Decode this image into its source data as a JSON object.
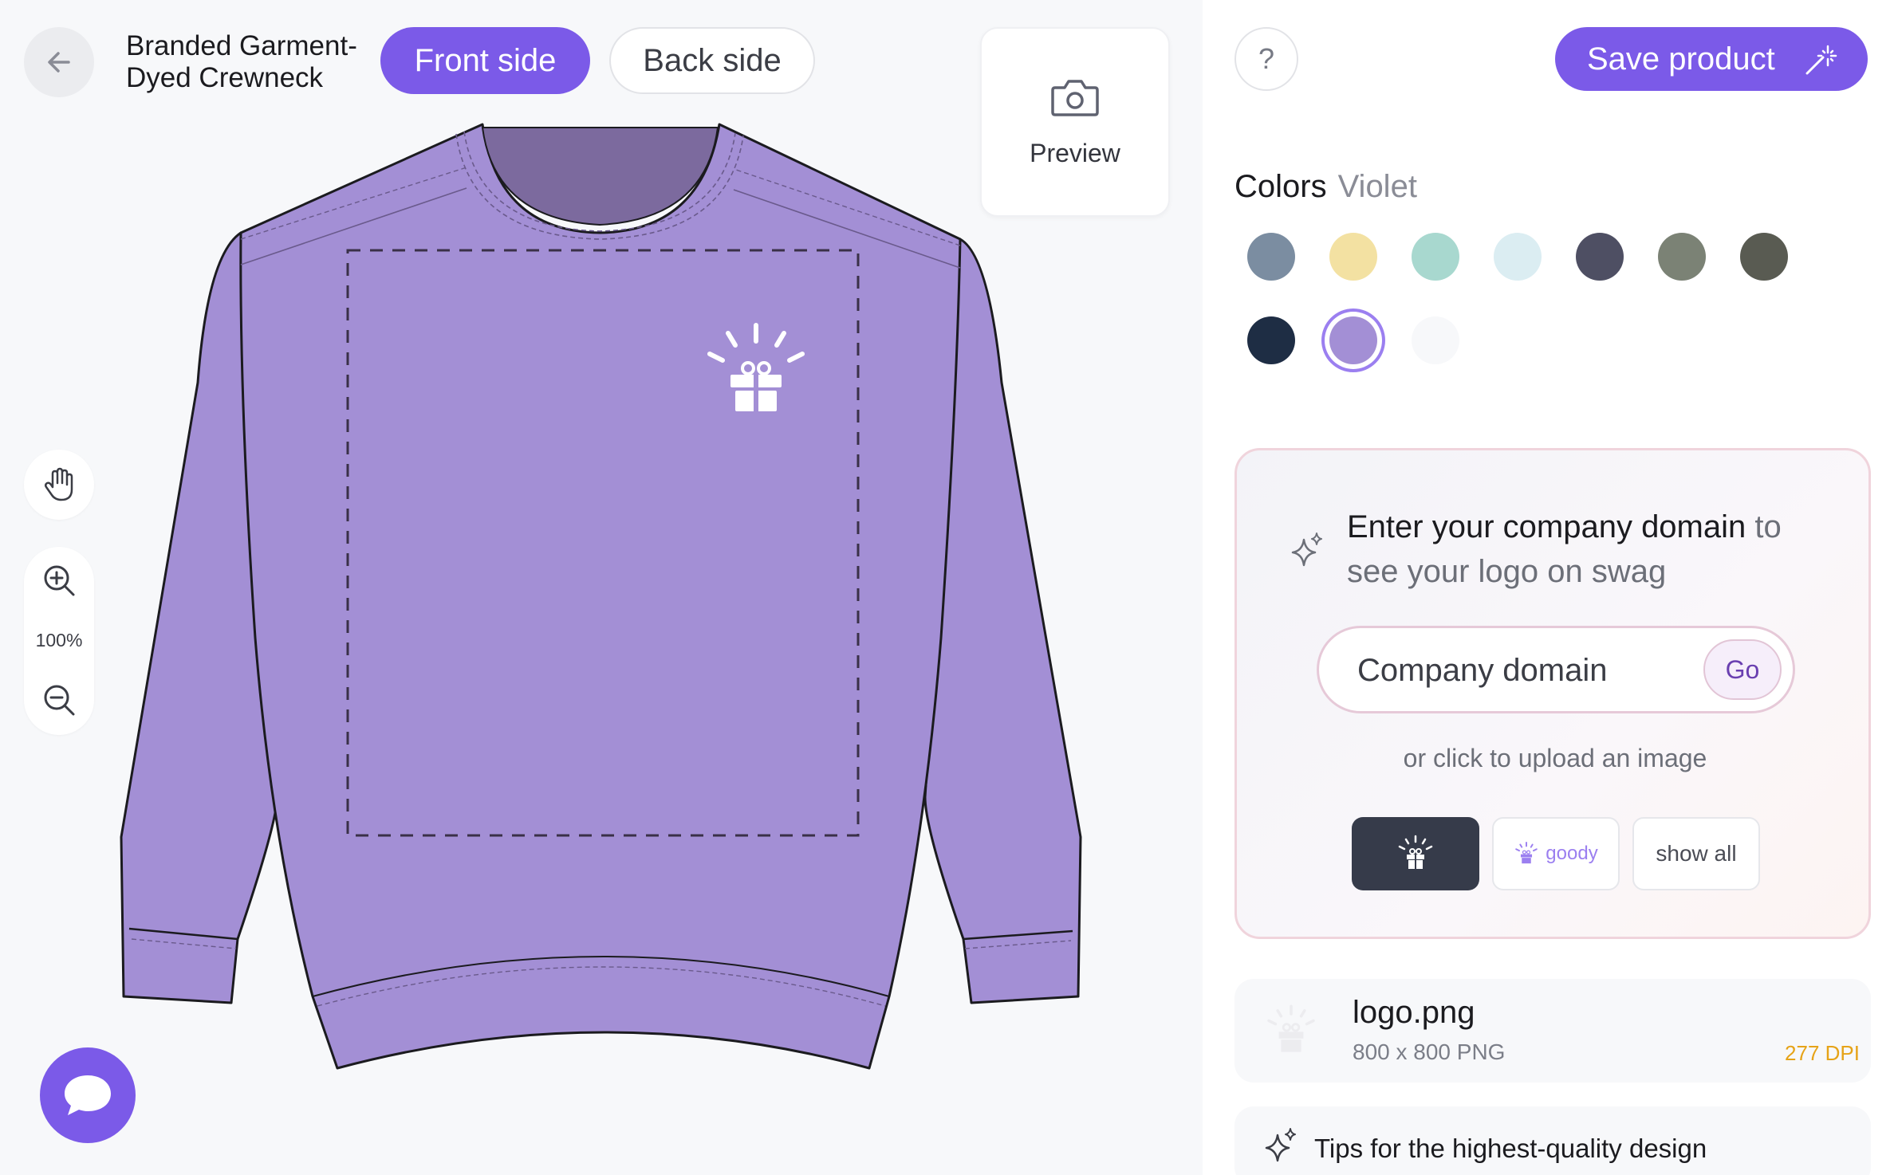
{
  "header": {
    "product_title": "Branded Garment-Dyed Crewneck",
    "tabs": [
      {
        "label": "Front side",
        "active": true
      },
      {
        "label": "Back side",
        "active": false
      }
    ],
    "preview_label": "Preview"
  },
  "canvas_tools": {
    "zoom_level": "100%",
    "icons": [
      "hand-icon",
      "zoom-in-icon",
      "zoom-out-icon",
      "chat-icon",
      "arrow-left-icon",
      "camera-icon"
    ]
  },
  "product": {
    "garment_color": "#a38fd5",
    "accent_color": "#7b5ae8"
  },
  "right_panel": {
    "help_label": "?",
    "save_label": "Save product",
    "colors": {
      "label": "Colors",
      "selected_name": "Violet",
      "swatches": [
        {
          "color": "#7b8da1",
          "selected": false
        },
        {
          "color": "#f3e1a2",
          "selected": false
        },
        {
          "color": "#a8d8cf",
          "selected": false
        },
        {
          "color": "#dbedf2",
          "selected": false
        },
        {
          "color": "#4e4f63",
          "selected": false
        },
        {
          "color": "#7b8275",
          "selected": false
        },
        {
          "color": "#595b52",
          "selected": false
        },
        {
          "color": "#1e2d44",
          "selected": false
        },
        {
          "color": "#a38fd5",
          "selected": true
        },
        {
          "color": "#f7f8fa",
          "selected": false
        }
      ]
    },
    "domain_card": {
      "headline_bold": "Enter your company domain",
      "headline_rest": " to see your logo on swag",
      "input_placeholder": "Company domain",
      "go_label": "Go",
      "upload_text": "or click to upload an image",
      "logo_options": {
        "goody_label": "goody",
        "show_all_label": "show all"
      }
    },
    "file": {
      "name": "logo.png",
      "meta": "800 x 800  PNG",
      "dpi": "277 DPI"
    },
    "tips": {
      "label": "Tips for the highest-quality design"
    }
  }
}
